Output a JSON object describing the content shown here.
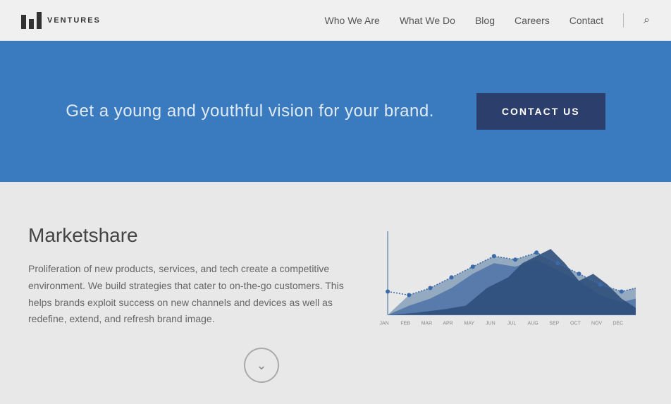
{
  "header": {
    "logo_bars": "|||",
    "logo_text": "VENTURES",
    "nav_items": [
      {
        "label": "Who We Are",
        "id": "who-we-are"
      },
      {
        "label": "What We Do",
        "id": "what-we-do"
      },
      {
        "label": "Blog",
        "id": "blog"
      },
      {
        "label": "Careers",
        "id": "careers"
      },
      {
        "label": "Contact",
        "id": "contact"
      }
    ]
  },
  "hero": {
    "tagline": "Get a young and youthful vision for your brand.",
    "cta_label": "CONTACT US"
  },
  "main": {
    "section_title": "Marketshare",
    "section_body": "Proliferation of new products, services, and tech create a competitive environment. We build strategies that cater to on-the-go customers. This helps brands exploit success on new channels and devices as well as redefine, extend, and refresh brand image.",
    "chart_months": [
      "JAN",
      "FEB",
      "MAR",
      "APR",
      "MAY",
      "JUN",
      "JUL",
      "AUG",
      "SEP",
      "OCT",
      "NOV",
      "DEC"
    ],
    "scroll_down_label": "↓"
  }
}
